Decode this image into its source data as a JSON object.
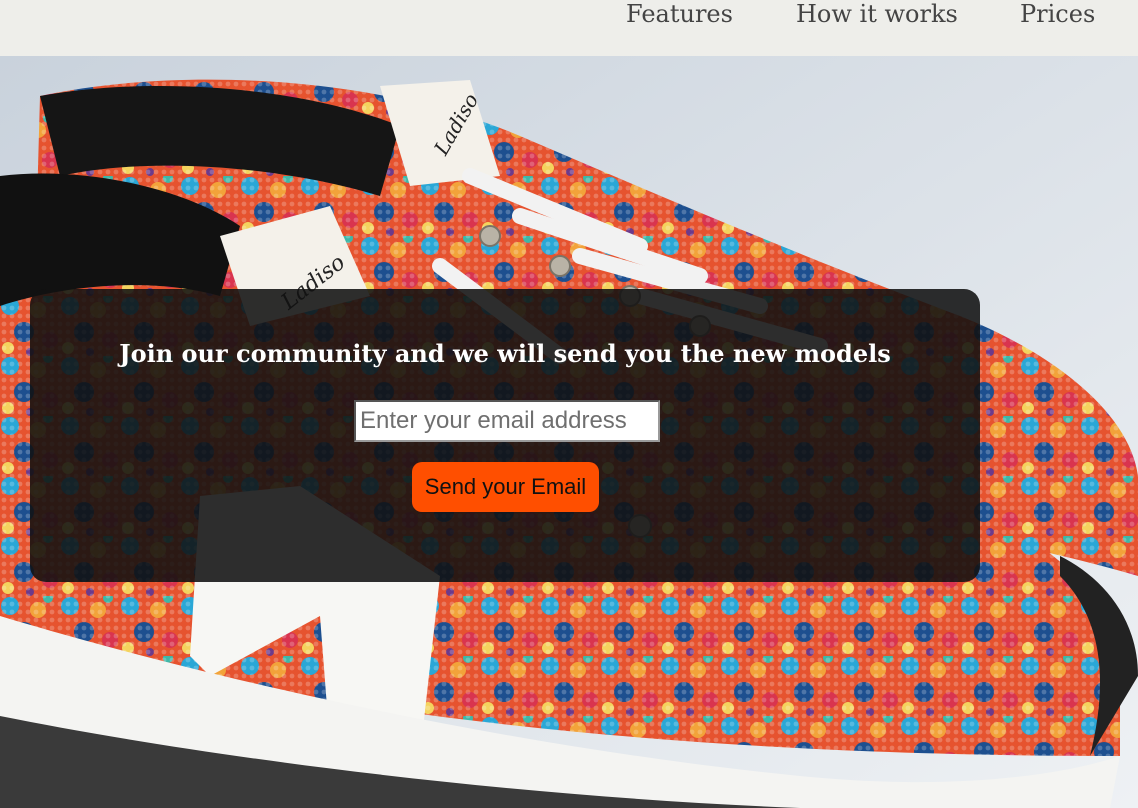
{
  "nav": {
    "links": [
      {
        "label": "Features"
      },
      {
        "label": "How it works"
      },
      {
        "label": "Prices"
      }
    ]
  },
  "hero": {
    "image_alt": "Colorful snakeskin-pattern sneakers",
    "shoe_brand_mark": "Ladiso"
  },
  "signup": {
    "headline": "Join our community and we will send you the new models",
    "email_placeholder": "Enter your email address",
    "email_value": "",
    "button_label": "Send your Email"
  },
  "colors": {
    "accent": "#ff4f00",
    "nav_background": "#eeeeea",
    "overlay": "#111111"
  }
}
